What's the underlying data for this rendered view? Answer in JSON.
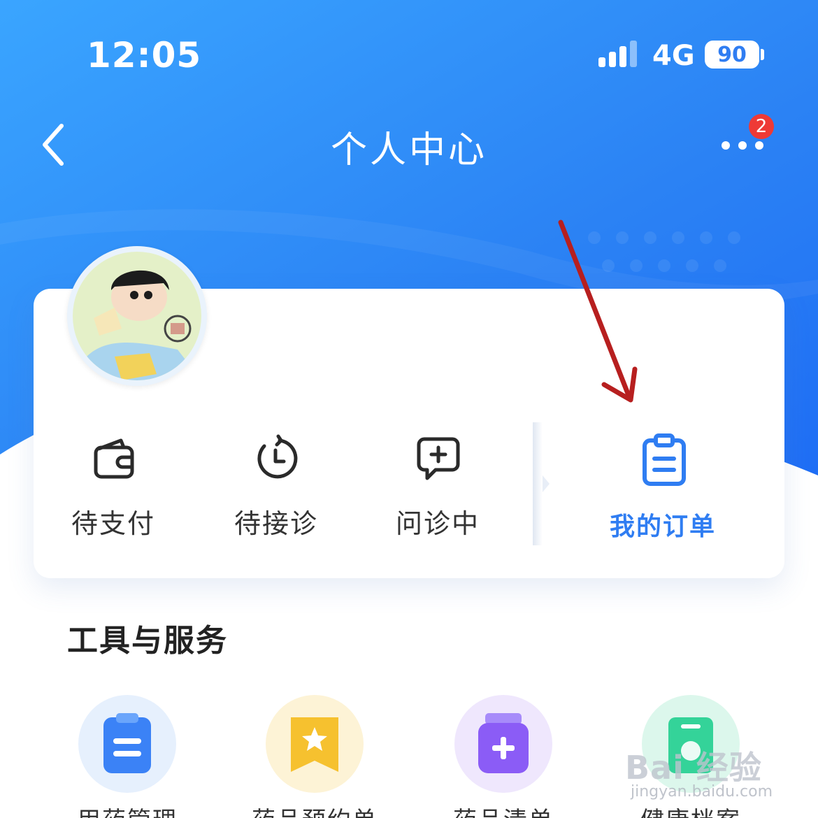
{
  "status_bar": {
    "time": "12:05",
    "network": "4G",
    "battery": "90"
  },
  "nav": {
    "title": "个人中心",
    "badge_count": "2"
  },
  "orders": {
    "items": [
      {
        "label": "待支付",
        "icon": "wallet-icon"
      },
      {
        "label": "待接诊",
        "icon": "clock-icon"
      },
      {
        "label": "问诊中",
        "icon": "chat-plus-icon"
      }
    ],
    "my_orders": {
      "label": "我的订单",
      "icon": "clipboard-icon"
    }
  },
  "tools": {
    "title": "工具与服务",
    "items": [
      {
        "label": "用药管理",
        "icon": "clipboard-list-icon",
        "color": "#3b82f6"
      },
      {
        "label": "药品预约单",
        "icon": "bookmark-star-icon",
        "color": "#f6c12f"
      },
      {
        "label": "药品清单",
        "icon": "medicine-jar-icon",
        "color": "#8b5cf6"
      },
      {
        "label": "健康档案",
        "icon": "health-record-icon",
        "color": "#34d399"
      }
    ]
  },
  "watermark": {
    "brand": "Bai 经验",
    "url": "jingyan.baidu.com"
  },
  "colors": {
    "primary": "#2f7df2",
    "badge": "#ee3a36",
    "header_gradient_start": "#3aa0ff",
    "header_gradient_end": "#1f6ef5"
  }
}
